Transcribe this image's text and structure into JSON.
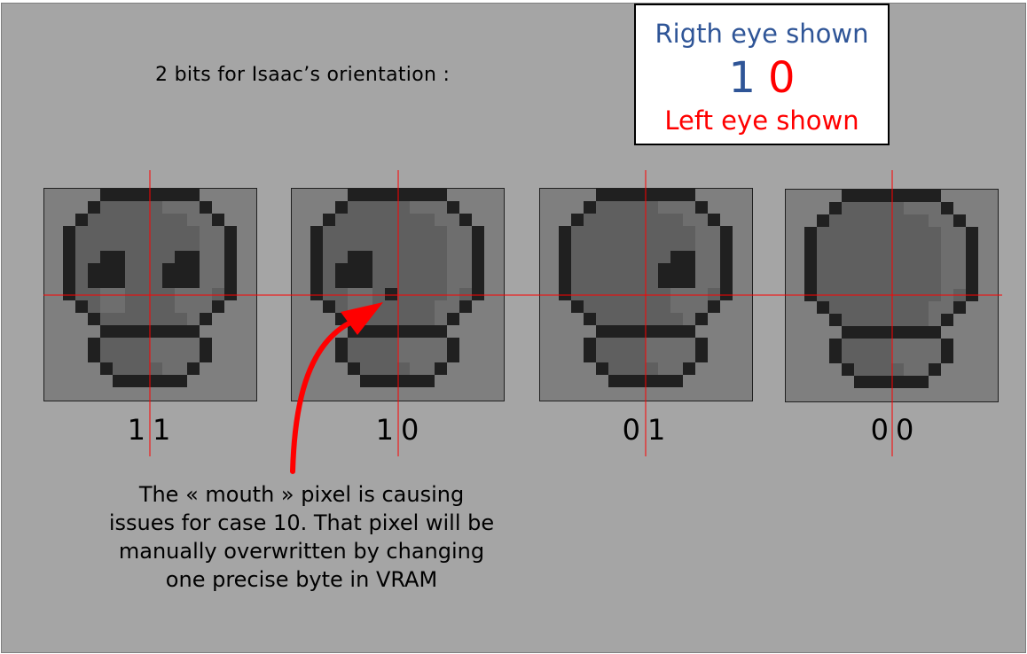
{
  "title": "2 bits for Isaac’s orientation :",
  "legend": {
    "right_eye": "Rigth eye shown",
    "bit_right": "1",
    "bit_left": "0",
    "left_eye": "Left eye shown"
  },
  "sprites": [
    {
      "label": "11",
      "right_eye": true,
      "left_eye": true,
      "mouth": false
    },
    {
      "label": "10",
      "right_eye": true,
      "left_eye": false,
      "mouth": true
    },
    {
      "label": "01",
      "right_eye": false,
      "left_eye": true,
      "mouth": false
    },
    {
      "label": "00",
      "right_eye": false,
      "left_eye": false,
      "mouth": false
    }
  ],
  "caption": "The « mouth » pixel is causing issues for case 10. That pixel will be manually overwritten by changing one precise byte in VRAM",
  "colors": {
    "background": "#a5a5a5",
    "sprite_bg": "#7f7f7f",
    "head": "#5f5f5f",
    "outline": "#202020",
    "shade": "#6e6e6e",
    "guide_line": "#ff0000",
    "arrow": "#ff0000",
    "right_bit": "#2f5597",
    "left_bit": "#ff0000"
  }
}
